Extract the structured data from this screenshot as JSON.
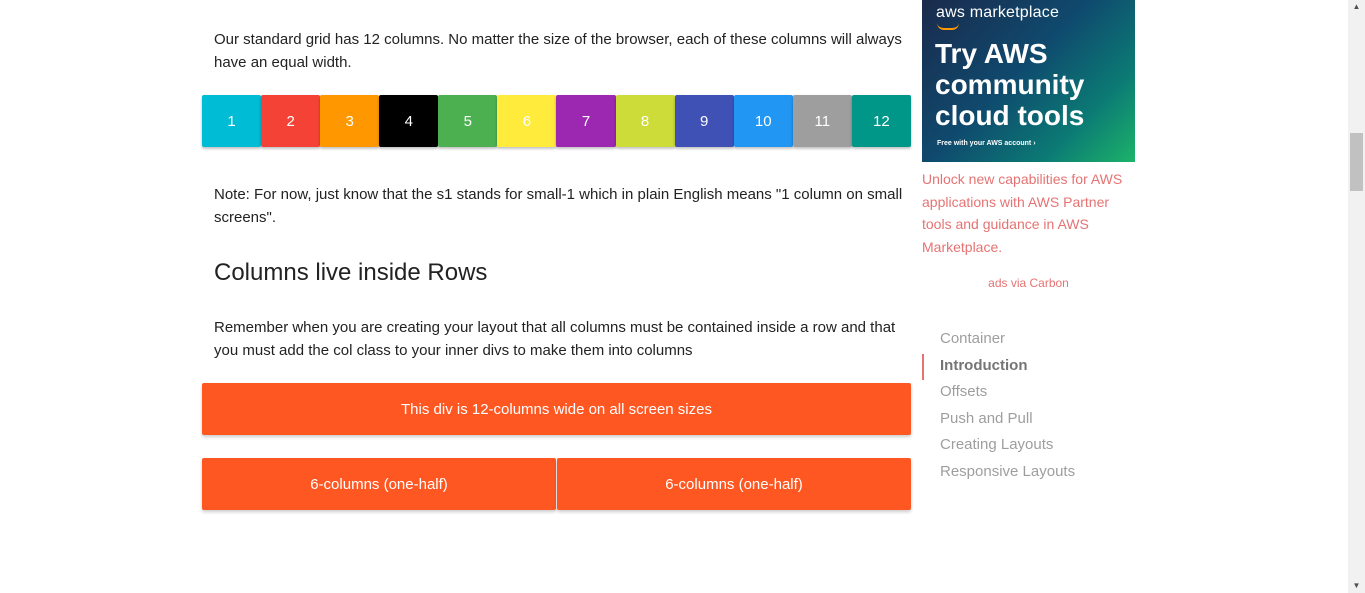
{
  "main": {
    "intro_text": "Our standard grid has 12 columns. No matter the size of the browser, each of these columns will always have an equal width.",
    "grid_cells": [
      {
        "label": "1",
        "color": "#00bcd4"
      },
      {
        "label": "2",
        "color": "#f44336"
      },
      {
        "label": "3",
        "color": "#ff9800"
      },
      {
        "label": "4",
        "color": "#000000"
      },
      {
        "label": "5",
        "color": "#4caf50"
      },
      {
        "label": "6",
        "color": "#ffeb3b"
      },
      {
        "label": "7",
        "color": "#9c27b0"
      },
      {
        "label": "8",
        "color": "#cddc39"
      },
      {
        "label": "9",
        "color": "#3f51b5"
      },
      {
        "label": "10",
        "color": "#2196f3"
      },
      {
        "label": "11",
        "color": "#9e9e9e"
      },
      {
        "label": "12",
        "color": "#009688"
      }
    ],
    "note_text": "Note: For now, just know that the s1 stands for small-1 which in plain English means \"1 column on small screens\".",
    "section_heading": "Columns live inside Rows",
    "rows_text": "Remember when you are creating your layout that all columns must be contained inside a row and that you must add the col class to your inner divs to make them into columns",
    "full_width_label": "This div is 12-columns wide on all screen sizes",
    "half_left_label": "6-columns (one-half)",
    "half_right_label": "6-columns (one-half)",
    "accent_color": "#ff5722"
  },
  "ad": {
    "brand": "aws marketplace",
    "headline": "Try AWS community cloud tools",
    "small_print": "Free with your AWS account ›",
    "description": "Unlock new capabilities for AWS applications with AWS Partner tools and guidance in AWS Marketplace.",
    "via": "ads via Carbon",
    "link_color": "#e57373"
  },
  "toc": {
    "items": [
      {
        "label": "Container",
        "active": false
      },
      {
        "label": "Introduction",
        "active": true
      },
      {
        "label": "Offsets",
        "active": false
      },
      {
        "label": "Push and Pull",
        "active": false
      },
      {
        "label": "Creating Layouts",
        "active": false
      },
      {
        "label": "Responsive Layouts",
        "active": false
      }
    ]
  },
  "scrollbar": {
    "up_icon": "scroll-up-arrow-icon",
    "down_icon": "scroll-down-arrow-icon"
  }
}
